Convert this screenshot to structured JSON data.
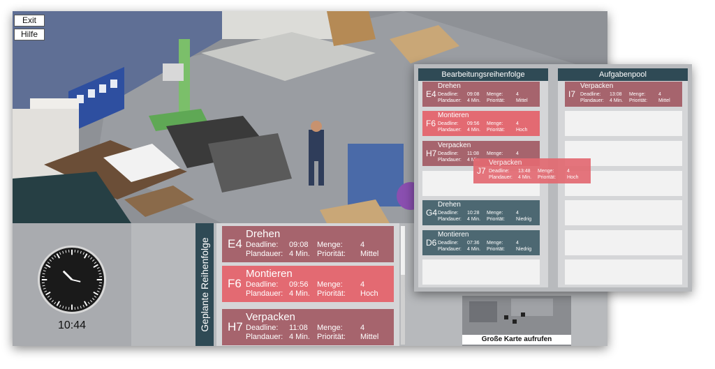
{
  "top_buttons": {
    "exit": "Exit",
    "help": "Hilfe"
  },
  "clock": {
    "time": "10:44"
  },
  "queue": {
    "label": "Geplante Reihenfolge",
    "field_labels": {
      "deadline": "Deadline:",
      "duration": "Plandauer:",
      "quantity": "Menge:",
      "priority": "Priorität:"
    },
    "cards": [
      {
        "code": "E4",
        "title": "Drehen",
        "deadline": "09:08",
        "duration": "4 Min.",
        "quantity": "4",
        "priority": "Mittel"
      },
      {
        "code": "F6",
        "title": "Montieren",
        "deadline": "09:56",
        "duration": "4 Min.",
        "quantity": "4",
        "priority": "Hoch"
      },
      {
        "code": "H7",
        "title": "Verpacken",
        "deadline": "11:08",
        "duration": "4 Min.",
        "quantity": "4",
        "priority": "Mittel"
      }
    ]
  },
  "map_button": "Große Karte aufrufen",
  "overlay": {
    "left_header": "Bearbeitungsreihenfolge",
    "right_header": "Aufgabenpool",
    "field_labels": {
      "deadline": "Deadline:",
      "duration": "Plandauer:",
      "quantity": "Menge:",
      "priority": "Priorität:"
    },
    "sequence": [
      {
        "code": "E4",
        "title": "Drehen",
        "deadline": "09:08",
        "duration": "4 Min.",
        "quantity": "4",
        "priority": "Mittel"
      },
      {
        "code": "F6",
        "title": "Montieren",
        "deadline": "09:56",
        "duration": "4 Min.",
        "quantity": "4",
        "priority": "Hoch"
      },
      {
        "code": "H7",
        "title": "Verpacken",
        "deadline": "11:08",
        "duration": "4 Min.",
        "quantity": "4",
        "priority": ""
      },
      {
        "code": "G4",
        "title": "Drehen",
        "deadline": "10:28",
        "duration": "4 Min.",
        "quantity": "4",
        "priority": "Niedrig"
      },
      {
        "code": "D6",
        "title": "Montieren",
        "deadline": "07:36",
        "duration": "4 Min.",
        "quantity": "4",
        "priority": "Niedrig"
      }
    ],
    "pool": [
      {
        "code": "I7",
        "title": "Verpacken",
        "deadline": "13:08",
        "duration": "4 Min.",
        "quantity": "4",
        "priority": "Mittel"
      }
    ],
    "dragging": {
      "code": "J7",
      "title": "Verpacken",
      "deadline": "13:48",
      "duration": "4 Min.",
      "quantity": "4",
      "priority": "Hoch"
    }
  }
}
